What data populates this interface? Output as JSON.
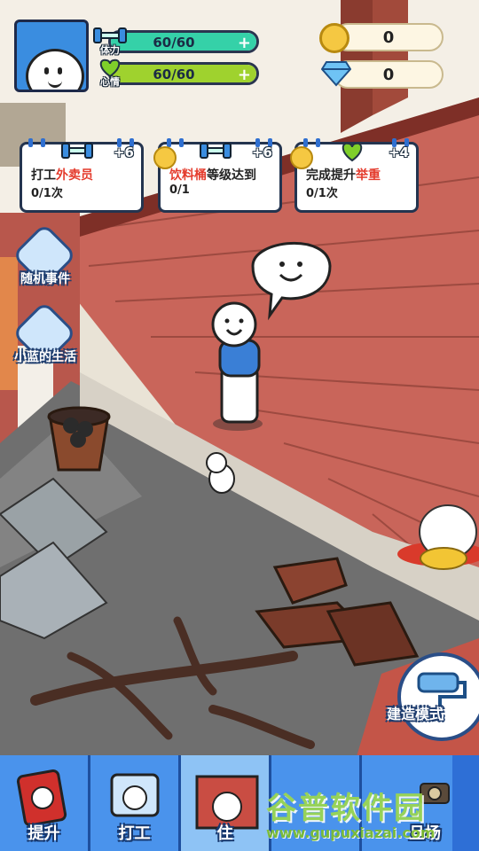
{
  "hud": {
    "stamina": {
      "label": "体力",
      "value": "60/60",
      "level": 1.0,
      "color": "#35d1a8"
    },
    "mood": {
      "label": "心情",
      "value": "60/60",
      "level": 1.0,
      "color": "#9fd22e"
    },
    "coins": "0",
    "gems": "0"
  },
  "tasks": [
    {
      "reward": "+6",
      "reward_icon": "dumbbell-icon",
      "text_pre": "打工",
      "text_hl": "外卖员",
      "text_post": "",
      "progress": "0/1次"
    },
    {
      "reward": "+6",
      "reward_icon": "dumbbell-icon",
      "text_pre": "",
      "text_hl": "饮料桶",
      "text_post": "等级达到",
      "progress": "0/1"
    },
    {
      "reward": "+4",
      "reward_icon": "heart-icon",
      "text_pre": "完成提升",
      "text_hl": "举重",
      "text_post": "",
      "progress": "0/1次"
    }
  ],
  "side": {
    "random_event": "随机事件",
    "life": "小蓝的生活"
  },
  "build_mode": "建造模式",
  "nav": {
    "upgrade": "提升",
    "work": "打工",
    "third": "住",
    "fourth": "",
    "fifth": "旦场"
  },
  "watermark": {
    "title": "谷普软件园",
    "url": "www.gupuxiazai.com"
  }
}
